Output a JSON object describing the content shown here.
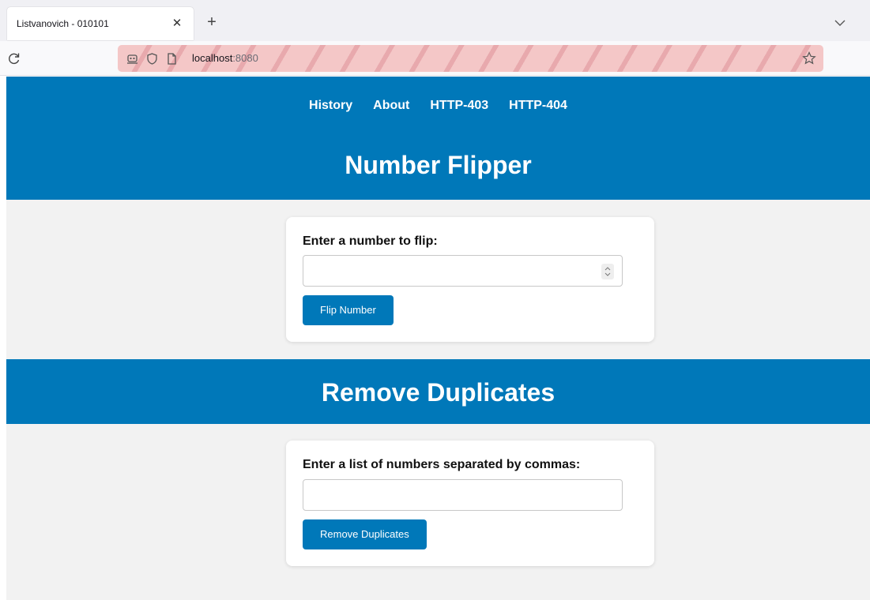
{
  "browser": {
    "tab_title": "Listvanovich - 010101",
    "url_host": "localhost",
    "url_port": ":8080"
  },
  "nav": {
    "items": [
      "History",
      "About",
      "HTTP-403",
      "HTTP-404"
    ]
  },
  "flipper": {
    "title": "Number Flipper",
    "label": "Enter a number to flip:",
    "input_value": "",
    "button": "Flip Number"
  },
  "duplicates": {
    "title": "Remove Duplicates",
    "label": "Enter a list of numbers separated by commas:",
    "input_value": "",
    "button": "Remove Duplicates"
  },
  "colors": {
    "brand": "#0078b9",
    "page_bg": "#f2f2f2"
  }
}
